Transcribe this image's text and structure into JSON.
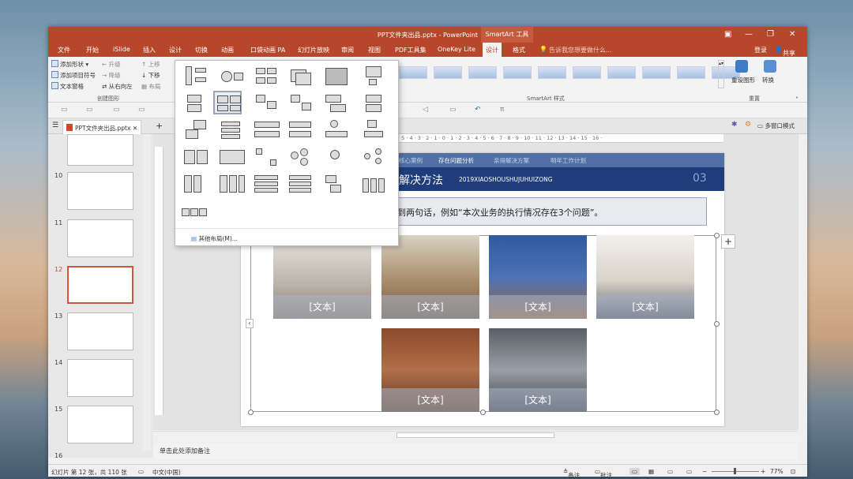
{
  "titlebar": {
    "title": "PPT文件夹出品.pptx - PowerPoint",
    "context_tab": "SmartArt 工具"
  },
  "menu": {
    "items": [
      "文件",
      "开始",
      "iSlide",
      "插入",
      "设计",
      "切换",
      "动画",
      "口袋动画 PA",
      "幻灯片放映",
      "审阅",
      "视图",
      "PDF工具集",
      "OneKey Lite",
      "设计",
      "格式"
    ],
    "tell_me": "告诉我您想要做什么...",
    "login": "登录",
    "share": "共享"
  },
  "ribbon": {
    "add_shape": "添加形状",
    "promote": "升级",
    "move_up": "上移",
    "add_bullet": "添加项目符号",
    "demote": "降级",
    "move_down": "下移",
    "text_pane": "文本窗格",
    "rtl": "从右向左",
    "layout": "布局",
    "group_create": "创建图形",
    "group_styles": "SmartArt 样式",
    "reset_graphic": "重设图形",
    "convert": "转换",
    "group_reset": "重置"
  },
  "doc_tab": {
    "label": "PPT文件夹出品.pptx"
  },
  "popup": {
    "more_layouts": "其他布局(M)..."
  },
  "thumbnails": [
    {
      "num": "10",
      "selected": false
    },
    {
      "num": "11",
      "selected": false
    },
    {
      "num": "12",
      "selected": true
    },
    {
      "num": "13",
      "selected": false
    },
    {
      "num": "14",
      "selected": false
    },
    {
      "num": "15",
      "selected": false
    },
    {
      "num": "16",
      "selected": false
    }
  ],
  "slide": {
    "tabs": [
      "核心案例",
      "存在问题分析",
      "亲得解决方案",
      "明年工作计划"
    ],
    "active_tab": "存在问题分析",
    "title": "解决方法",
    "subtitle": "2019XIAOSHOUSHUJUHUIZONG",
    "number": "03",
    "banner": "到两句话，例如“本次业务的执行情况存在3个问题”。",
    "photo_label": "[文本]"
  },
  "notes": {
    "placeholder": "单击此处添加备注"
  },
  "statusbar": {
    "slide_info": "幻灯片 第 12 张，共 110 张",
    "language": "中文(中国)",
    "notes": "备注",
    "comments": "批注",
    "zoom": "77%",
    "multiwindow": "多窗口模式"
  },
  "colors": {
    "accent": "#b7472a",
    "slide_header": "#1f3d7a",
    "slide_tabs": "#4f6fa5"
  }
}
